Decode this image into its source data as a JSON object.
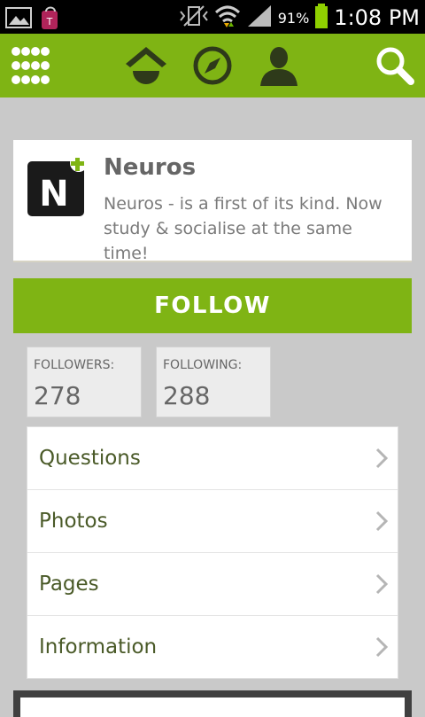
{
  "status_bar": {
    "icons": [
      "gallery-icon",
      "tmobile-icon",
      "vibrate-icon",
      "wifi-icon",
      "signal-icon",
      "battery-icon"
    ],
    "battery_percent": "91%",
    "time": "1:08 PM"
  },
  "app_bar": {
    "icons": [
      "grid-menu-icon",
      "home-icon",
      "compass-icon",
      "profile-icon",
      "search-icon"
    ],
    "accent_color": "#7fb414"
  },
  "profile": {
    "name": "Neuros",
    "description": "Neuros - is a first of its kind. Now study & socialise at the same time!"
  },
  "follow_button": {
    "label": "FOLLOW"
  },
  "stats": {
    "followers": {
      "label": "FOLLOWERS:",
      "value": "278"
    },
    "following": {
      "label": "FOLLOWING:",
      "value": "288"
    }
  },
  "menu": {
    "items": [
      {
        "label": "Questions"
      },
      {
        "label": "Photos"
      },
      {
        "label": "Pages"
      },
      {
        "label": "Information"
      }
    ]
  }
}
